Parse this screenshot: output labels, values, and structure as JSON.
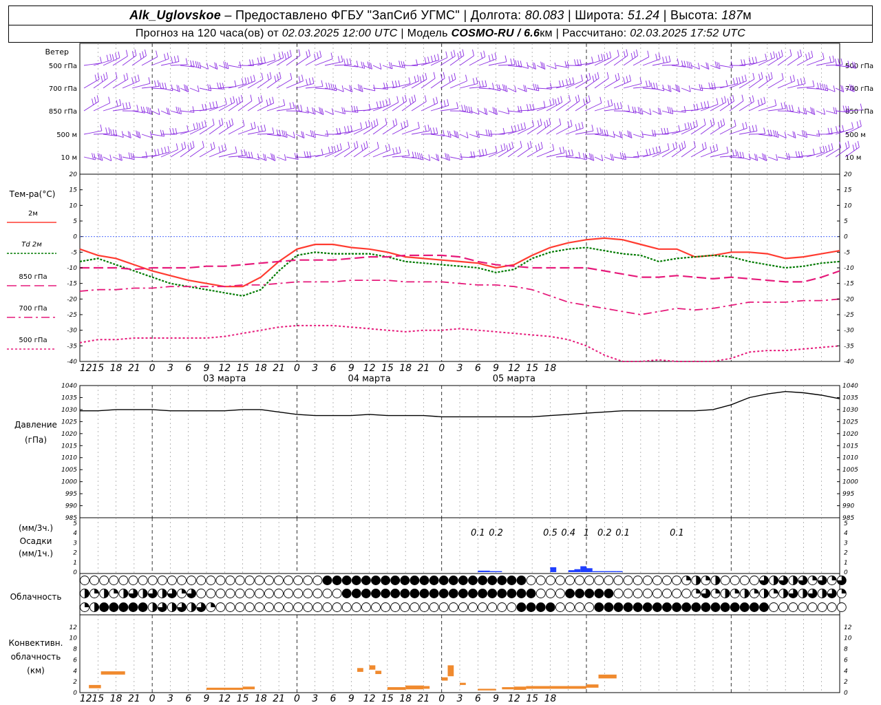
{
  "header": {
    "station": "Alk_Uglovskoe",
    "provider": "– Предоставлено ФГБУ \"ЗапСиб УГМС\"",
    "lon_label": "Долгота:",
    "lon_value": "80.083",
    "lat_label": "Широта:",
    "lat_value": "51.24",
    "alt_label": "Высота:",
    "alt_value": "187",
    "alt_unit": "м",
    "forecast_label": "Прогноз на 120 часа(ов) от",
    "forecast_start": "02.03.2025 12:00 UTC",
    "model_label": "Модель",
    "model_name": "COSMO-RU / 6.6",
    "model_unit": "км",
    "computed_label": "Рассчитано:",
    "computed_value": "02.03.2025 17:52 UTC"
  },
  "panels": {
    "wind": {
      "title": "Ветер",
      "levels": [
        "500 гПа",
        "700 гПа",
        "850 гПа",
        "500 м",
        "10 м"
      ],
      "color": "#8a2be2"
    },
    "temp": {
      "title": "Тем-ра(°C)",
      "legend": [
        "2м",
        "Td 2м",
        "850 гПа",
        "700 гПа",
        "500 гПа"
      ]
    },
    "pressure": {
      "title": "Давление",
      "unit": "(гПа)"
    },
    "precip": {
      "title": "Осадки",
      "unit_top": "(мм/3ч.)",
      "unit_bottom": "(мм/1ч.)"
    },
    "cloud": {
      "title": "Облачность"
    },
    "convective": {
      "title_lines": [
        "Конвективн.",
        "облачность",
        "(км)"
      ]
    }
  },
  "time_axis": {
    "hour_labels": [
      "12",
      "15",
      "18",
      "21",
      "0",
      "3",
      "6",
      "9",
      "12",
      "15",
      "18",
      "21",
      "0",
      "3",
      "6",
      "9",
      "12",
      "15",
      "18",
      "21",
      "0",
      "3",
      "6",
      "9",
      "12",
      "15",
      "18"
    ],
    "day_labels": [
      "03 марта",
      "04 марта",
      "05 марта"
    ]
  },
  "colors": {
    "t2m": "#ff3b30",
    "td2m": "#007a00",
    "t850": "#e6197a",
    "t700": "#e6197a",
    "t500": "#e6197a",
    "zero_line": "#3355ff",
    "pressure": "#000000",
    "precip": "#1f3fff",
    "convective": "#f08a2e",
    "wind": "#8a2be2"
  },
  "chart_data": [
    {
      "type": "line",
      "title": "Тем-ра(°C)",
      "x_hours": [
        0,
        3,
        6,
        9,
        12,
        15,
        18,
        21,
        24,
        27,
        30,
        33,
        36,
        39,
        42,
        45,
        48,
        51,
        54,
        57,
        60,
        63,
        66,
        69,
        72,
        75,
        78,
        81,
        84,
        87,
        90,
        93,
        96,
        99,
        102,
        105,
        108,
        111,
        114,
        117,
        120,
        123,
        126
      ],
      "ylim": [
        -40,
        20
      ],
      "series": [
        {
          "name": "2м",
          "values": [
            -4,
            -6,
            -7,
            -9,
            -11,
            -12.5,
            -14,
            -15,
            -16,
            -16,
            -13,
            -8,
            -4,
            -2.5,
            -2.5,
            -3.5,
            -4,
            -5,
            -6.5,
            -7,
            -7.5,
            -8,
            -8.5,
            -10,
            -9,
            -6,
            -3.5,
            -2,
            -1,
            -0.5,
            -1,
            -2.5,
            -4,
            -4,
            -6.5,
            -6,
            -5,
            -5,
            -5.5,
            -7,
            -6.5,
            -5.5,
            -4.5
          ]
        },
        {
          "name": "Td 2м",
          "values": [
            -8,
            -7,
            -9,
            -11,
            -13,
            -15,
            -16,
            -17,
            -18,
            -19,
            -17,
            -11,
            -6,
            -5,
            -5.5,
            -5.5,
            -5.5,
            -6.5,
            -8,
            -8.5,
            -9,
            -9.5,
            -10,
            -11.5,
            -10.5,
            -7,
            -5,
            -4,
            -3.5,
            -4.5,
            -5.5,
            -6,
            -8,
            -7,
            -6.5,
            -6,
            -6.5,
            -8,
            -9,
            -10,
            -9.5,
            -8.5,
            -8
          ]
        },
        {
          "name": "850 гПа",
          "values": [
            -10,
            -10,
            -10,
            -10.5,
            -10,
            -10,
            -10,
            -9.5,
            -9.5,
            -9,
            -8.5,
            -8,
            -7.5,
            -7.5,
            -7.5,
            -7,
            -6.5,
            -6.5,
            -6,
            -6,
            -6,
            -6.5,
            -8,
            -9,
            -9.5,
            -10,
            -10,
            -10,
            -10,
            -11,
            -12,
            -13,
            -13,
            -12.5,
            -13,
            -13.5,
            -13,
            -13.5,
            -14,
            -14.5,
            -14.5,
            -13,
            -11
          ]
        },
        {
          "name": "700 гПа",
          "values": [
            -17.5,
            -17,
            -17,
            -16.5,
            -16.5,
            -16,
            -16,
            -16,
            -16,
            -15.5,
            -15.5,
            -15,
            -14.5,
            -14.5,
            -14.5,
            -14,
            -14,
            -14,
            -14.5,
            -14.5,
            -14.5,
            -15,
            -15.5,
            -15.5,
            -16,
            -17,
            -19,
            -21,
            -22,
            -23,
            -24,
            -25,
            -24,
            -23,
            -23.5,
            -23,
            -22,
            -21,
            -21,
            -21,
            -20.5,
            -20.5,
            -20
          ]
        },
        {
          "name": "500 гПа",
          "values": [
            -34,
            -33,
            -33,
            -32.5,
            -32.5,
            -32.5,
            -32.5,
            -32.5,
            -32,
            -31,
            -30,
            -29,
            -28.5,
            -28.5,
            -28.5,
            -29,
            -29.5,
            -30,
            -30.5,
            -30,
            -30,
            -29.5,
            -30,
            -30.5,
            -31,
            -31.5,
            -32,
            -33,
            -35,
            -38,
            -40,
            -40,
            -39.5,
            -41,
            -42,
            -41,
            -39,
            -37,
            -36.5,
            -36.5,
            -36,
            -35.5,
            -35
          ]
        }
      ]
    },
    {
      "type": "line",
      "title": "Давление",
      "ylabel": "(гПа)",
      "x_hours": [
        0,
        3,
        6,
        9,
        12,
        15,
        18,
        21,
        24,
        27,
        30,
        33,
        36,
        39,
        42,
        45,
        48,
        51,
        54,
        57,
        60,
        63,
        66,
        69,
        72,
        75,
        78,
        81,
        84,
        87,
        90,
        93,
        96,
        99,
        102,
        105,
        108,
        111,
        114,
        117,
        120,
        123,
        126
      ],
      "ylim": [
        985,
        1040
      ],
      "series": [
        {
          "name": "",
          "values": [
            1029.5,
            1029.5,
            1030,
            1030,
            1030,
            1029.5,
            1029.5,
            1029.5,
            1029.5,
            1030,
            1030,
            1029,
            1028,
            1027.5,
            1027.5,
            1027.5,
            1028,
            1027.5,
            1027.5,
            1027.5,
            1027,
            1027,
            1027,
            1027,
            1027,
            1027,
            1027.5,
            1028,
            1028.5,
            1029,
            1029.5,
            1029.5,
            1029.5,
            1029.5,
            1029.5,
            1030,
            1032,
            1035,
            1036.5,
            1037.5,
            1037,
            1036,
            1034.5
          ]
        }
      ]
    },
    {
      "type": "bar",
      "title": "Осадки",
      "ylabel": "(мм/1ч.)",
      "ylim": [
        0,
        5
      ],
      "labels_3h": [
        {
          "hour": 66,
          "value": "0.1"
        },
        {
          "hour": 69,
          "value": "0.2"
        },
        {
          "hour": 78,
          "value": "0.5"
        },
        {
          "hour": 81,
          "value": "0.4"
        },
        {
          "hour": 84,
          "value": "1"
        },
        {
          "hour": 87,
          "value": "0.2"
        },
        {
          "hour": 90,
          "value": "0.1"
        },
        {
          "hour": 99,
          "value": "0.1"
        }
      ],
      "bars_1h": [
        {
          "hour": 67,
          "value": 0.15
        },
        {
          "hour": 68,
          "value": 0.15
        },
        {
          "hour": 69,
          "value": 0.1
        },
        {
          "hour": 70,
          "value": 0.1
        },
        {
          "hour": 79,
          "value": 0.5
        },
        {
          "hour": 82,
          "value": 0.2
        },
        {
          "hour": 83,
          "value": 0.3
        },
        {
          "hour": 84,
          "value": 0.6
        },
        {
          "hour": 85,
          "value": 0.4
        },
        {
          "hour": 86,
          "value": 0.1
        },
        {
          "hour": 87,
          "value": 0.1
        },
        {
          "hour": 88,
          "value": 0.1
        },
        {
          "hour": 89,
          "value": 0.1
        },
        {
          "hour": 90,
          "value": 0.1
        }
      ]
    },
    {
      "type": "bar",
      "title": "Конвективн. облачность (км)",
      "ylim": [
        0,
        14
      ],
      "segments": [
        {
          "h0": 1.5,
          "h1": 3.5,
          "bottom": 0.8,
          "top": 1.4
        },
        {
          "h0": 3.5,
          "h1": 7.5,
          "bottom": 3.3,
          "top": 3.9
        },
        {
          "h0": 21,
          "h1": 27,
          "bottom": 0.5,
          "top": 0.9
        },
        {
          "h0": 27,
          "h1": 29,
          "bottom": 0.6,
          "top": 1.1
        },
        {
          "h0": 46,
          "h1": 47,
          "bottom": 3.8,
          "top": 4.5
        },
        {
          "h0": 48,
          "h1": 49,
          "bottom": 4.2,
          "top": 5.0
        },
        {
          "h0": 49,
          "h1": 50,
          "bottom": 3.4,
          "top": 4.0
        },
        {
          "h0": 51,
          "h1": 54,
          "bottom": 0.5,
          "top": 1.0
        },
        {
          "h0": 54,
          "h1": 57,
          "bottom": 0.6,
          "top": 1.3
        },
        {
          "h0": 57,
          "h1": 58,
          "bottom": 0.7,
          "top": 1.2
        },
        {
          "h0": 60,
          "h1": 61,
          "bottom": 2.2,
          "top": 2.8
        },
        {
          "h0": 61,
          "h1": 62,
          "bottom": 3.0,
          "top": 5.0
        },
        {
          "h0": 63,
          "h1": 64,
          "bottom": 1.4,
          "top": 1.8
        },
        {
          "h0": 66,
          "h1": 69,
          "bottom": 0.4,
          "top": 0.7
        },
        {
          "h0": 70,
          "h1": 72,
          "bottom": 0.6,
          "top": 1.0
        },
        {
          "h0": 72,
          "h1": 74,
          "bottom": 0.5,
          "top": 1.1
        },
        {
          "h0": 74,
          "h1": 78,
          "bottom": 0.7,
          "top": 1.2
        },
        {
          "h0": 78,
          "h1": 84,
          "bottom": 0.7,
          "top": 1.2
        },
        {
          "h0": 84,
          "h1": 86,
          "bottom": 0.9,
          "top": 1.5
        },
        {
          "h0": 86,
          "h1": 89,
          "bottom": 2.6,
          "top": 3.3
        }
      ]
    }
  ]
}
